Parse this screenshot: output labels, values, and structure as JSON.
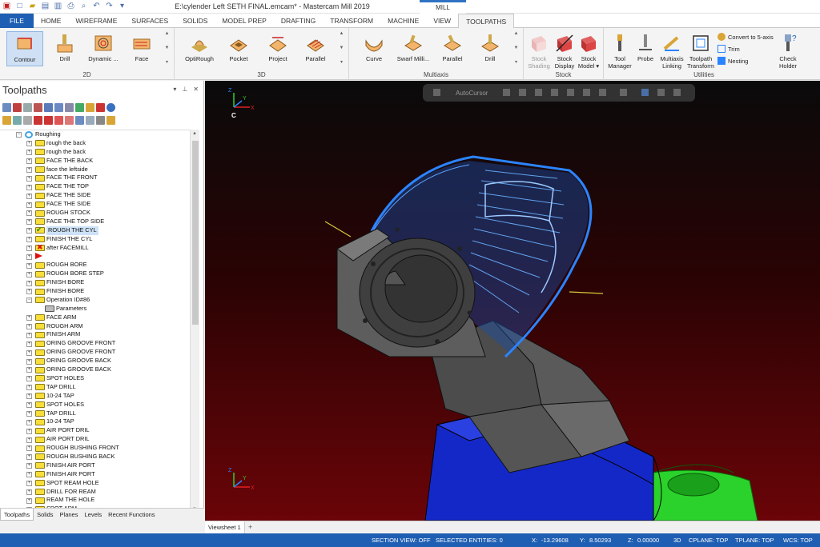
{
  "window": {
    "title": "E:\\cylender Left SETH FINAL.emcam* - Mastercam Mill 2019",
    "context_tab": "MILL"
  },
  "tabs": [
    "FILE",
    "HOME",
    "WIREFRAME",
    "SURFACES",
    "SOLIDS",
    "MODEL PREP",
    "DRAFTING",
    "TRANSFORM",
    "MACHINE",
    "VIEW",
    "TOOLPATHS"
  ],
  "active_tab": "TOOLPATHS",
  "ribbon": {
    "groups": {
      "g2d": "2D",
      "g3d": "3D",
      "gmulti": "Multiaxis",
      "gstock": "Stock",
      "gutil": "Utilities"
    },
    "b2d": [
      "Contour",
      "Drill",
      "Dynamic ...",
      "Face"
    ],
    "b3d": [
      "OptiRough",
      "Pocket",
      "Project",
      "Parallel"
    ],
    "bmulti": [
      "Curve",
      "Swarf Milli...",
      "Parallel",
      "Drill"
    ],
    "bstock": [
      {
        "l1": "Stock",
        "l2": "Shading"
      },
      {
        "l1": "Stock",
        "l2": "Display"
      },
      {
        "l1": "Stock",
        "l2": "Model ▾"
      }
    ],
    "butil": [
      {
        "l1": "Tool",
        "l2": "Manager"
      },
      {
        "l1": "Probe",
        "l2": ""
      },
      {
        "l1": "Multiaxis",
        "l2": "Linking"
      },
      {
        "l1": "Toolpath",
        "l2": "Transform"
      }
    ],
    "small": [
      "Convert to 5-axis",
      "Trim",
      "Nesting"
    ],
    "check": {
      "l1": "Check",
      "l2": "Holder"
    }
  },
  "panel": {
    "title": "Toolpaths",
    "root": "Roughing",
    "items": [
      "rough the back",
      "rough the back",
      "FACE THE BACK",
      "face the leftside",
      "FACE THE FRONT",
      "FACE THE TOP",
      "FACE THE SIDE",
      "FACE THE SIDE",
      "ROUGH STOCK",
      "FACE THE TOP SIDE",
      "ROUGH THE CYL",
      "FINISH THE CYL",
      "after FACEMILL",
      "",
      "ROUGH BORE",
      "ROUGH BORE STEP",
      "FINISH BORE",
      "FINISH BORE",
      "Operation ID#86",
      "Parameters",
      "FACE ARM",
      "ROUGH ARM",
      "FINISH ARM",
      "ORING GROOVE FRONT",
      "ORING GROOVE FRONT",
      "ORING GROOVE BACK",
      "ORING GROOVE BACK",
      "SPOT HOLES",
      "TAP DRILL",
      "10-24 TAP",
      "SPOT HOLES",
      "TAP DRILL",
      "10-24 TAP",
      "AIR PORT DRIL",
      "AIR PORT DRIL",
      "ROUGH BUSHING FRONT",
      "ROUGH BUSHING BACK",
      "FINISH AIR PORT",
      "FINISH AIR PORT",
      "SPOT REAM HOLE",
      "DRILL FOR REAM",
      "REAM THE HOLE",
      "SPOT ARM"
    ],
    "tabs": [
      "Toolpaths",
      "Solids",
      "Planes",
      "Levels",
      "Recent Functions"
    ]
  },
  "viewport": {
    "sheet_tab": "Viewsheet 1",
    "add_tab": "+",
    "toolbar_label": "AutoCursor",
    "axis": {
      "x": "X",
      "y": "Y",
      "z": "Z",
      "c": "C"
    }
  },
  "status": {
    "section_view": "SECTION VIEW: OFF",
    "selected": "SELECTED ENTITIES: 0",
    "x_label": "X:",
    "x": "-13.29608",
    "y_label": "Y:",
    "y": "8.50293",
    "z_label": "Z:",
    "z": "0.00000",
    "mode": "3D",
    "cplane": "CPLANE: TOP",
    "tplane": "TPLANE: TOP",
    "wcs": "WCS: TOP"
  },
  "colors": {
    "accent": "#1f5fb3",
    "toolpath": "#2b84ff",
    "part": "#5a5a5a",
    "fixture": "#1428c8",
    "base": "#2bd22b"
  }
}
